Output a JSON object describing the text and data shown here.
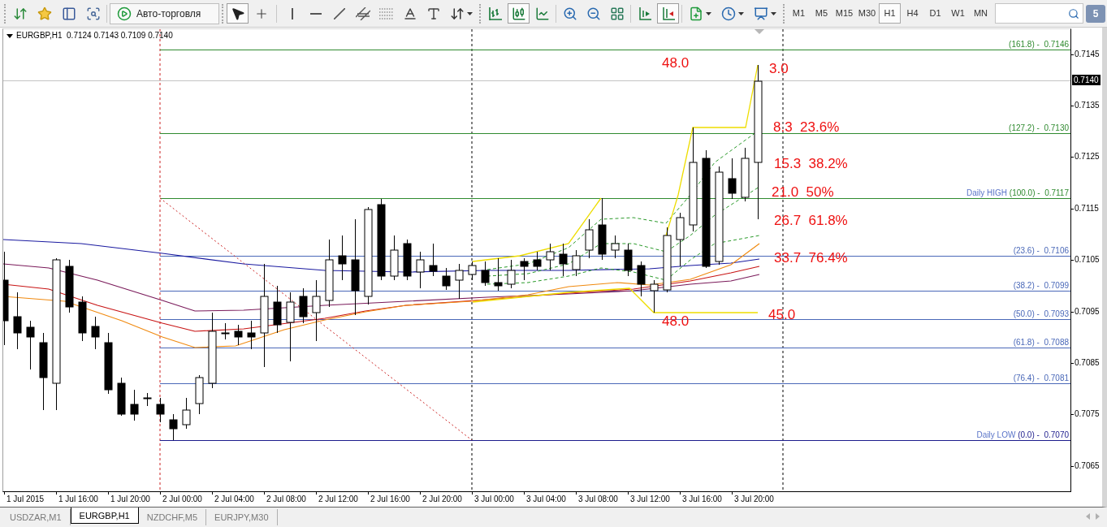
{
  "toolbar": {
    "autotrading_button": {
      "label": "Авто-торговля"
    },
    "drawing_tools": [
      {
        "selected": true
      },
      {
        "selected": false
      },
      {
        "selected": false
      },
      {
        "selected": false
      },
      {
        "selected": false
      },
      {
        "selected": false
      },
      {
        "selected": false
      },
      {
        "selected": false
      },
      {
        "selected": false
      },
      {
        "selected": false
      }
    ],
    "chart_types": [
      {
        "selected": false
      },
      {
        "selected": true
      },
      {
        "selected": false
      }
    ],
    "chart_view": [
      {
        "selected": false
      },
      {
        "selected": true
      }
    ],
    "timeframes": [
      {
        "label": "M1",
        "selected": false
      },
      {
        "label": "M5",
        "selected": false
      },
      {
        "label": "M15",
        "selected": false
      },
      {
        "label": "M30",
        "selected": false
      },
      {
        "label": "H1",
        "selected": true
      },
      {
        "label": "H4",
        "selected": false
      },
      {
        "label": "D1",
        "selected": false
      },
      {
        "label": "W1",
        "selected": false
      },
      {
        "label": "MN",
        "selected": false
      }
    ],
    "notifications": {
      "count": "5"
    }
  },
  "chart": {
    "header": "EURGBP,H1  0.7124 0.7143 0.7109 0.7140",
    "fibonacci_levels": [
      {
        "label": "(161.8) -  0.7146",
        "color": "#2f8a2f"
      },
      {
        "label": "(127.2) -  0.7130",
        "color": "#2f8a2f"
      },
      {
        "prefix": "Daily HIGH",
        "label": "(100.0) -  0.7117",
        "color": "#2f8a2f"
      },
      {
        "label": "(23.6) -  0.7106",
        "color": "#4a68b8"
      },
      {
        "label": "(38.2) -  0.7099",
        "color": "#4a68b8"
      },
      {
        "label": "(50.0) -  0.7093",
        "color": "#4a68b8"
      },
      {
        "label": "(61.8) -  0.7088",
        "color": "#4a68b8"
      },
      {
        "label": "(76.4) -  0.7081",
        "color": "#4a68b8"
      },
      {
        "prefix": "Daily LOW",
        "label": "(0.0) -  0.7070",
        "color": "#1c1c8c"
      }
    ],
    "annotations": [
      "48.0",
      "3.0",
      "8.3  23.6%",
      "15.3  38.2%",
      "21.0  50%",
      "26.7  61.8%",
      "33.7  76.4%",
      "48.0",
      "45.0"
    ],
    "price_axis": {
      "ticks": [
        "0.7145",
        "0.7135",
        "0.7125",
        "0.7115",
        "0.7105",
        "0.7095",
        "0.7085",
        "0.7075",
        "0.7065"
      ],
      "current_price": "0.7140"
    },
    "time_axis": {
      "labels": [
        "1 Jul 2015",
        "1 Jul 16:00",
        "1 Jul 20:00",
        "2 Jul 00:00",
        "2 Jul 04:00",
        "2 Jul 08:00",
        "2 Jul 12:00",
        "2 Jul 16:00",
        "2 Jul 20:00",
        "3 Jul 00:00",
        "3 Jul 04:00",
        "3 Jul 08:00",
        "3 Jul 12:00",
        "3 Jul 16:00",
        "3 Jul 20:00"
      ]
    }
  },
  "tabs": [
    {
      "label": "USDZAR,M1",
      "selected": false
    },
    {
      "label": "EURGBP,H1",
      "selected": true
    },
    {
      "label": "NZDCHF,M5",
      "selected": false
    },
    {
      "label": "EURJPY,M30",
      "selected": false
    }
  ]
}
